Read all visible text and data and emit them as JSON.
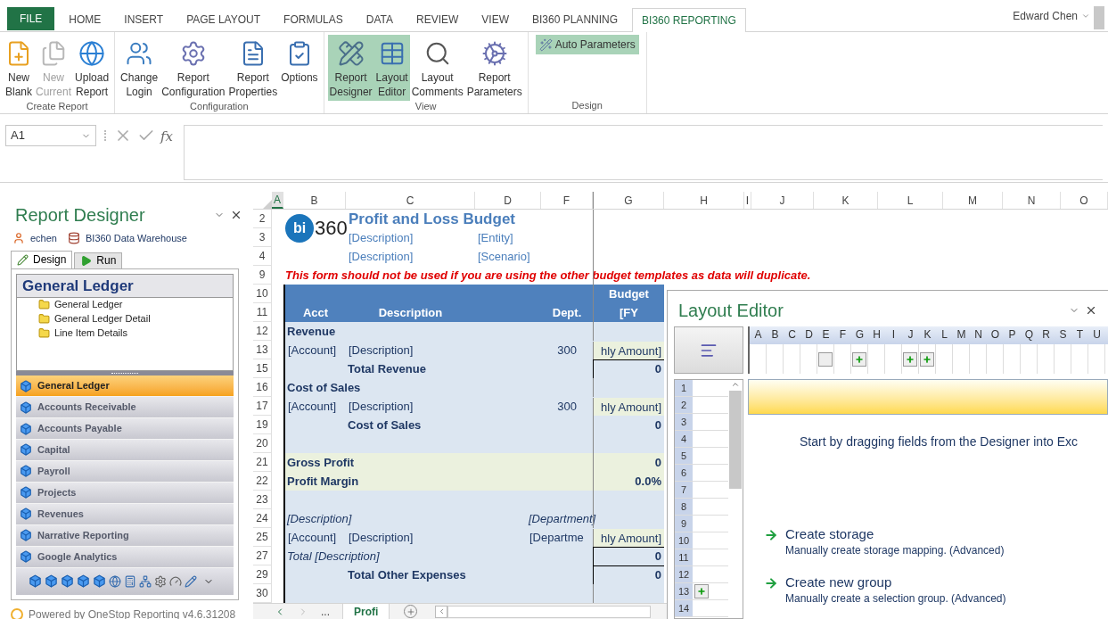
{
  "ribbon_tabs": [
    {
      "label": "FILE",
      "kind": "file",
      "selected": false
    },
    {
      "label": "HOME",
      "kind": "tab",
      "selected": false
    },
    {
      "label": "INSERT",
      "kind": "tab",
      "selected": false
    },
    {
      "label": "PAGE LAYOUT",
      "kind": "tab",
      "selected": false
    },
    {
      "label": "FORMULAS",
      "kind": "tab",
      "selected": false
    },
    {
      "label": "DATA",
      "kind": "tab",
      "selected": false
    },
    {
      "label": "REVIEW",
      "kind": "tab",
      "selected": false
    },
    {
      "label": "VIEW",
      "kind": "tab",
      "selected": false
    },
    {
      "label": "BI360 PLANNING",
      "kind": "tab",
      "selected": false
    },
    {
      "label": "BI360 REPORTING",
      "kind": "tab",
      "selected": true
    }
  ],
  "account": {
    "name": "Edward Chen"
  },
  "ribbon_groups": [
    {
      "label": "Create Report",
      "buttons": [
        {
          "kind": "new",
          "label": [
            "New",
            "Blank"
          ],
          "selected": false,
          "disabled": false
        },
        {
          "kind": "current",
          "label": [
            "New",
            "Current"
          ],
          "selected": false,
          "disabled": true
        },
        {
          "kind": "upload",
          "label": [
            "Upload",
            "Report"
          ],
          "selected": false,
          "disabled": false
        }
      ]
    },
    {
      "label": "Configuration",
      "buttons": [
        {
          "kind": "login",
          "label": [
            "Change",
            "Login"
          ],
          "selected": false,
          "disabled": false
        },
        {
          "kind": "config",
          "label": [
            "Report",
            "Configuration"
          ],
          "selected": false,
          "disabled": false
        },
        {
          "kind": "properties",
          "label": [
            "Report",
            "Properties"
          ],
          "selected": false,
          "disabled": false
        },
        {
          "kind": "options",
          "label": [
            "Options"
          ],
          "selected": false,
          "disabled": false
        }
      ]
    },
    {
      "label": "View",
      "buttons": [
        {
          "kind": "designer",
          "label": [
            "Report",
            "Designer"
          ],
          "selected": true,
          "disabled": false
        },
        {
          "kind": "layout",
          "label": [
            "Layout",
            "Editor"
          ],
          "selected": true,
          "disabled": false
        },
        {
          "kind": "comments",
          "label": [
            "Layout",
            "Comments"
          ],
          "selected": false,
          "disabled": false
        },
        {
          "kind": "parameters",
          "label": [
            "Report",
            "Parameters"
          ],
          "selected": false,
          "disabled": false
        }
      ]
    },
    {
      "label": "Design",
      "buttons": [
        {
          "kind": "auto",
          "label": [
            "Auto Parameters"
          ],
          "selected": true,
          "disabled": false
        }
      ]
    }
  ],
  "formula_bar": {
    "name_box": "A1",
    "function_label": "fx"
  },
  "report_designer": {
    "title": "Report Designer",
    "user": "echen",
    "source": "BI360 Data Warehouse",
    "tabs": [
      {
        "label": "Design",
        "kind": "design",
        "selected": true
      },
      {
        "label": "Run",
        "kind": "run",
        "selected": false
      }
    ],
    "heading": "General Ledger",
    "tree": [
      {
        "label": "General Ledger"
      },
      {
        "label": "General Ledger Detail"
      },
      {
        "label": "Line Item Details"
      }
    ],
    "modules": [
      {
        "label": "General Ledger",
        "selected": true
      },
      {
        "label": "Accounts Receivable",
        "selected": false
      },
      {
        "label": "Accounts Payable",
        "selected": false
      },
      {
        "label": "Capital",
        "selected": false
      },
      {
        "label": "Payroll",
        "selected": false
      },
      {
        "label": "Projects",
        "selected": false
      },
      {
        "label": "Revenues",
        "selected": false
      },
      {
        "label": "Narrative Reporting",
        "selected": false
      },
      {
        "label": "Google Analytics",
        "selected": false
      }
    ],
    "footer": "Powered by OneStop Reporting v4.6.31208"
  },
  "sheet": {
    "columns": [
      {
        "label": "A",
        "selected": true
      },
      {
        "label": "B",
        "selected": false
      },
      {
        "label": "C",
        "selected": false
      },
      {
        "label": "D",
        "selected": false
      },
      {
        "label": "F",
        "selected": false
      },
      {
        "label": "G",
        "selected": false
      },
      {
        "label": "H",
        "selected": false
      },
      {
        "label": "I",
        "selected": false
      },
      {
        "label": "J",
        "selected": false
      },
      {
        "label": "K",
        "selected": false
      },
      {
        "label": "L",
        "selected": false
      },
      {
        "label": "M",
        "selected": false
      },
      {
        "label": "N",
        "selected": false
      },
      {
        "label": "O",
        "selected": false
      }
    ],
    "rows": [
      {
        "row": "2",
        "kind": "plain",
        "b": {
          "kind": "logo",
          "mark": "bi",
          "text": "360"
        },
        "c": {
          "kind": "title",
          "text": "Profit and Loss Budget"
        }
      },
      {
        "row": "3",
        "kind": "plain",
        "c": {
          "kind": "field",
          "text": "[Description]"
        },
        "d": {
          "kind": "field",
          "text": "[Entity]"
        }
      },
      {
        "row": "4",
        "kind": "plain",
        "c": {
          "kind": "field",
          "text": "[Description]"
        },
        "d": {
          "kind": "field",
          "text": "[Scenario]"
        }
      },
      {
        "row": "9",
        "kind": "plain",
        "b": {
          "kind": "warning",
          "text": "This form should not be used if you are using the other budget templates as data will duplicate."
        }
      },
      {
        "row": "10",
        "kind": "header",
        "g": {
          "kind": "head",
          "text": "Budget"
        }
      },
      {
        "row": "11",
        "kind": "header",
        "b": {
          "kind": "head",
          "text": "Acct"
        },
        "c": {
          "kind": "head",
          "text": "Description"
        },
        "f": {
          "kind": "head",
          "text": "Dept."
        },
        "g": {
          "kind": "head",
          "text": "[FY"
        }
      },
      {
        "row": "12",
        "kind": "body",
        "b": {
          "kind": "group",
          "text": "Revenue"
        }
      },
      {
        "row": "13",
        "kind": "body",
        "b": {
          "kind": "text",
          "text": "[Account]"
        },
        "c": {
          "kind": "text",
          "text": "[Description]"
        },
        "f": {
          "kind": "num",
          "text": "300"
        },
        "g": {
          "kind": "amount",
          "text": "hly Amount]"
        }
      },
      {
        "row": "15",
        "kind": "body",
        "c": {
          "kind": "group",
          "text": "Total Revenue"
        },
        "g": {
          "kind": "total",
          "text": "0"
        }
      },
      {
        "row": "16",
        "kind": "body",
        "b": {
          "kind": "group",
          "text": "Cost of Sales"
        }
      },
      {
        "row": "17",
        "kind": "body",
        "b": {
          "kind": "text",
          "text": "[Account]"
        },
        "c": {
          "kind": "text",
          "text": "[Description]"
        },
        "f": {
          "kind": "num",
          "text": "300"
        },
        "g": {
          "kind": "amount",
          "text": "hly Amount]"
        }
      },
      {
        "row": "19",
        "kind": "body",
        "c": {
          "kind": "group",
          "text": "Cost of Sales"
        },
        "g": {
          "kind": "sum",
          "text": "0"
        }
      },
      {
        "row": "20",
        "kind": "body"
      },
      {
        "row": "21",
        "kind": "margin",
        "b": {
          "kind": "group",
          "text": "Gross Profit"
        },
        "g": {
          "kind": "sum",
          "text": "0"
        }
      },
      {
        "row": "22",
        "kind": "margin",
        "b": {
          "kind": "group",
          "text": "Profit Margin"
        },
        "g": {
          "kind": "sum",
          "text": "0.0%"
        }
      },
      {
        "row": "23",
        "kind": "body"
      },
      {
        "row": "24",
        "kind": "body",
        "b": {
          "kind": "italic",
          "text": "[Description]"
        },
        "d": {
          "kind": "dept",
          "text": "[Department]"
        }
      },
      {
        "row": "25",
        "kind": "body",
        "b": {
          "kind": "text",
          "text": "[Account]"
        },
        "c": {
          "kind": "text",
          "text": "[Description]"
        },
        "d": {
          "kind": "deptcut",
          "text": "[Departme"
        },
        "g": {
          "kind": "amount",
          "text": "hly Amount]"
        }
      },
      {
        "row": "27",
        "kind": "body",
        "b": {
          "kind": "italic",
          "text": "Total [Description]"
        },
        "g": {
          "kind": "total",
          "text": "0"
        }
      },
      {
        "row": "29",
        "kind": "body",
        "c": {
          "kind": "group",
          "text": "Total Other Expenses"
        },
        "g": {
          "kind": "total",
          "text": "0"
        }
      },
      {
        "row": "30",
        "kind": "body"
      }
    ],
    "sheet_tabs": [
      {
        "label": "Profi",
        "selected": true
      }
    ],
    "more_tabs": "..."
  },
  "layout_editor": {
    "title": "Layout Editor",
    "grid_columns": [
      {
        "label": "A",
        "kind": "blank"
      },
      {
        "label": "B",
        "kind": "blank"
      },
      {
        "label": "C",
        "kind": "blank"
      },
      {
        "label": "D",
        "kind": "blank"
      },
      {
        "label": "E",
        "kind": "empty"
      },
      {
        "label": "F",
        "kind": "blank"
      },
      {
        "label": "G",
        "kind": "add"
      },
      {
        "label": "H",
        "kind": "blank"
      },
      {
        "label": "I",
        "kind": "blank"
      },
      {
        "label": "J",
        "kind": "add"
      },
      {
        "label": "K",
        "kind": "add"
      },
      {
        "label": "L",
        "kind": "blank"
      },
      {
        "label": "M",
        "kind": "blank"
      },
      {
        "label": "N",
        "kind": "blank"
      },
      {
        "label": "O",
        "kind": "blank"
      },
      {
        "label": "P",
        "kind": "blank"
      },
      {
        "label": "Q",
        "kind": "blank"
      },
      {
        "label": "R",
        "kind": "blank"
      },
      {
        "label": "S",
        "kind": "blank"
      },
      {
        "label": "T",
        "kind": "blank"
      },
      {
        "label": "U",
        "kind": "blank"
      }
    ],
    "grid_rows": [
      {
        "label": "1",
        "kind": "blank"
      },
      {
        "label": "2",
        "kind": "blank"
      },
      {
        "label": "3",
        "kind": "blank"
      },
      {
        "label": "4",
        "kind": "blank"
      },
      {
        "label": "5",
        "kind": "blank"
      },
      {
        "label": "6",
        "kind": "blank"
      },
      {
        "label": "7",
        "kind": "blank"
      },
      {
        "label": "8",
        "kind": "blank"
      },
      {
        "label": "9",
        "kind": "blank"
      },
      {
        "label": "10",
        "kind": "blank"
      },
      {
        "label": "11",
        "kind": "blank"
      },
      {
        "label": "12",
        "kind": "blank"
      },
      {
        "label": "13",
        "kind": "add"
      },
      {
        "label": "14",
        "kind": "blank"
      }
    ],
    "hint": "Start by dragging fields from the Designer into Exc",
    "actions": [
      {
        "title": "Create storage",
        "description": "Manually create storage mapping. (Advanced)"
      },
      {
        "title": "Create new group",
        "description": "Manually create a selection group. (Advanced)"
      }
    ]
  }
}
